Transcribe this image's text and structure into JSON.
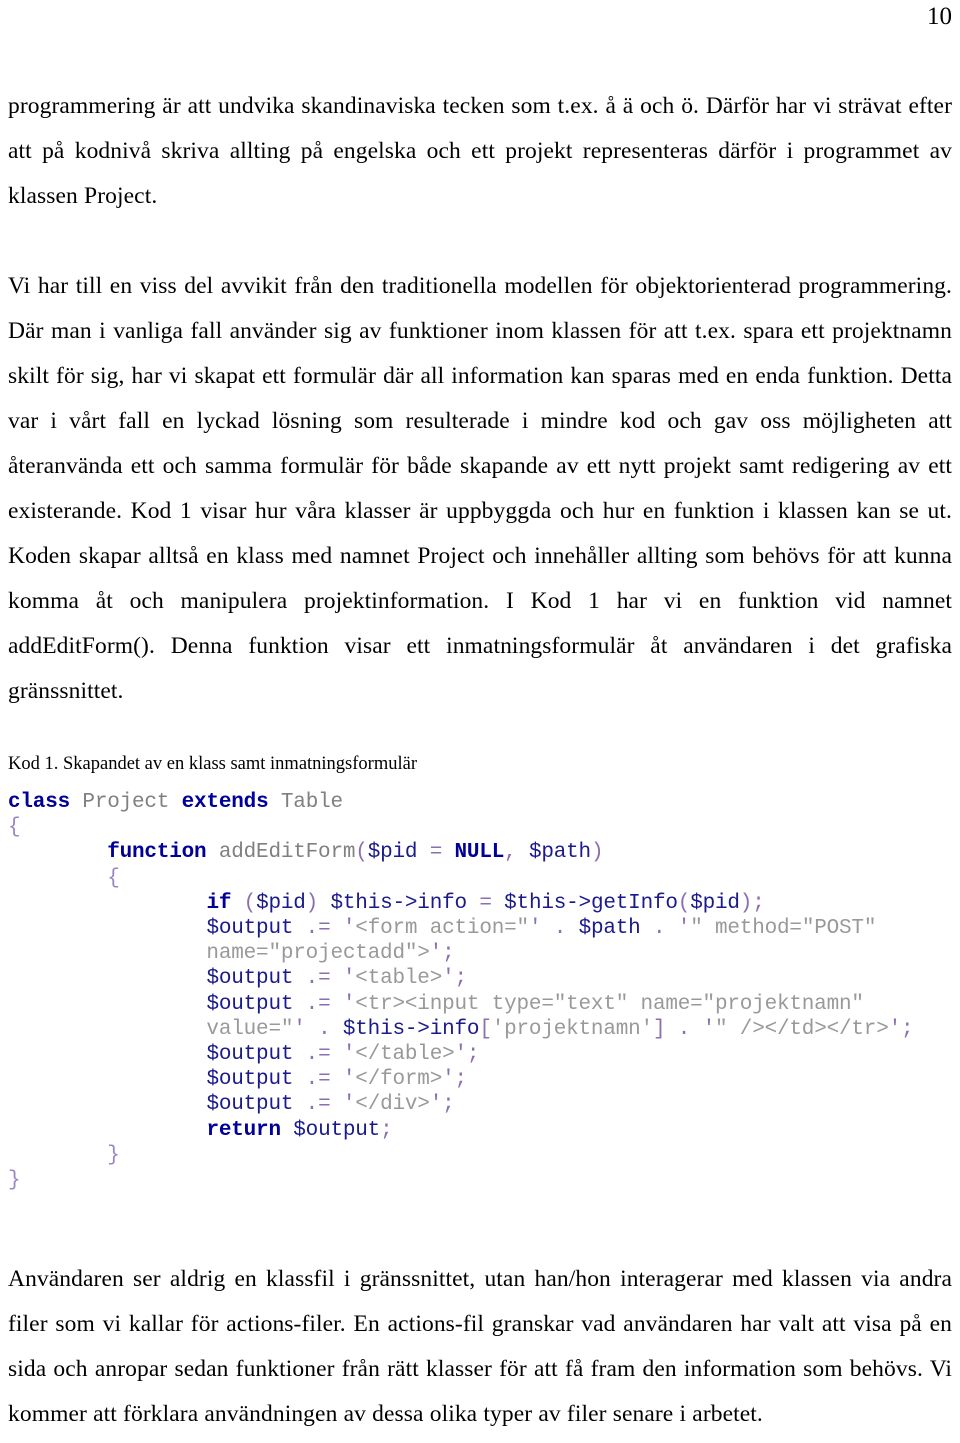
{
  "page": {
    "number": "10"
  },
  "paragraphs": [
    {
      "id": "p1",
      "text": "programmering är att undvika skandinaviska tecken som t.ex. å ä och ö. Därför har vi strävat efter att på kodnivå skriva allting på engelska och ett projekt representeras därför i programmet av klassen Project."
    },
    {
      "id": "p2",
      "text": "Vi har till en viss del avvikit från den traditionella modellen för objektorienterad programmering. Där man i vanliga fall använder sig av funktioner inom klassen för att t.ex. spara ett projektnamn skilt för sig, har vi skapat ett formulär där all information kan sparas med en enda funktion. Detta var i vårt fall en lyckad lösning som resulterade i mindre kod och gav oss möjligheten att återanvända ett och samma formulär för både skapande av ett nytt projekt samt redigering av ett existerande. Kod 1 visar hur våra klasser är uppbyggda och hur en funktion i klassen kan se ut. Koden skapar alltså en klass med namnet Project och innehåller allting som behövs för att kunna komma åt och manipulera projektinformation. I Kod 1 har vi en funktion vid namnet addEditForm(). Denna funktion visar ett inmatningsformulär åt användaren i det grafiska gränssnittet."
    },
    {
      "id": "p3",
      "text": "Användaren ser aldrig en klassfil i gränssnittet, utan han/hon interagerar med klassen via andra filer som vi kallar för actions-filer. En actions-fil granskar vad användaren har valt att visa på en sida och anropar sedan funktioner från rätt klasser för att få fram den information som behövs. Vi kommer att förklara användningen av dessa olika typer av filer senare i arbetet."
    }
  ],
  "code_block": {
    "caption": "Kod 1. Skapandet av en klass samt inmatningsformulär",
    "language": "php",
    "colors": {
      "keyword": "#000099",
      "identifier": "#808080",
      "string": "#999999",
      "variable": "#1a1a8c",
      "brace": "#9a86c4",
      "punctuation": "#8b6fb0"
    },
    "lines": [
      "class Project extends Table",
      "{",
      "        function addEditForm($pid = NULL, $path)",
      "        {",
      "                if ($pid) $this->info = $this->getInfo($pid);",
      "                $output .= '<form action=\"' . $path . '\" method=\"POST\"",
      "                name=\"projectadd\">';",
      "                $output .= '<table>';",
      "                $output .= '<tr><input type=\"text\" name=\"projektnamn\"",
      "                value=\"' . $this->info['projektnamn'] . '\" /></td></tr>';",
      "                $output .= '</table>';",
      "                $output .= '</form>';",
      "                $output .= '</div>';",
      "                return $output;",
      "        }",
      "}"
    ],
    "plain_text": "class Project extends Table\n{\n        function addEditForm($pid = NULL, $path)\n        {\n                if ($pid) $this->info = $this->getInfo($pid);\n                $output .= '<form action=\"' . $path . '\" method=\"POST\"\n                name=\"projectadd\">';\n                $output .= '<table>';\n                $output .= '<tr><input type=\"text\" name=\"projektnamn\"\n                value=\"' . $this->info['projektnamn'] . '\" /></td></tr>';\n                $output .= '</table>';\n                $output .= '</form>';\n                $output .= '</div>';\n                return $output;\n        }\n}"
  }
}
